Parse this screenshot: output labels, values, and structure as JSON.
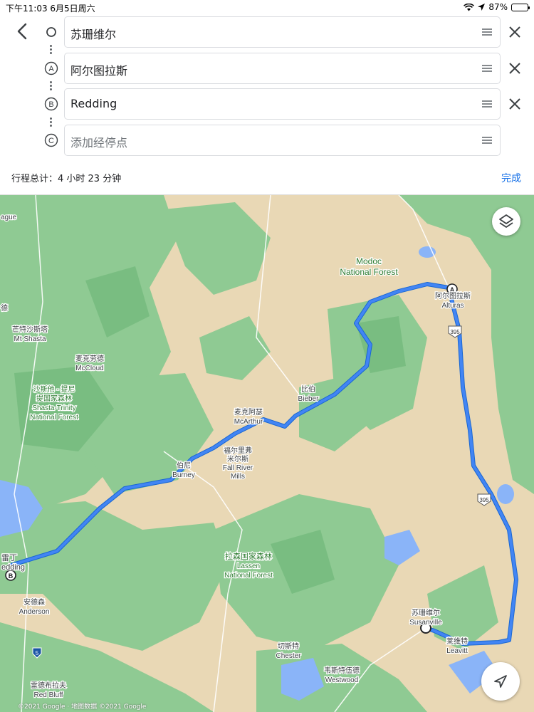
{
  "status_bar": {
    "time_date": "下午11:03   6月5日周六",
    "battery": "87%",
    "battery_level": 0.87
  },
  "route": {
    "stops": [
      {
        "marker": "",
        "value": "苏珊维尔"
      },
      {
        "marker": "A",
        "value": "阿尔图拉斯"
      },
      {
        "marker": "B",
        "value": "Redding"
      },
      {
        "marker": "C",
        "placeholder": "添加经停点"
      }
    ],
    "trip_total": "行程总计：4 小时 23 分钟",
    "done_label": "完成"
  },
  "map": {
    "colors": {
      "route": "#4285f4",
      "forest": "#8bc98b",
      "desert": "#e9d8b5",
      "water": "#8ab4f8"
    },
    "labels": {
      "modoc_cn": "Modoc",
      "modoc_en": "National Forest",
      "alturas_cn": "阿尔图拉斯",
      "alturas_en": "Alturas",
      "mtshasta_cn": "芒特沙斯塔",
      "mtshasta_en": "Mt Shasta",
      "mccloud_cn": "麦克劳德",
      "mccloud_en": "McCloud",
      "shasta_trinity_cn1": "沙斯他 - 提尼",
      "shasta_trinity_cn2": "提国家森林",
      "shasta_trinity_en1": "Shasta-Trinity",
      "shasta_trinity_en2": "National Forest",
      "bieber_cn": "比伯",
      "bieber_en": "Bieber",
      "mcarthur_cn": "麦克阿瑟",
      "mcarthur_en": "McArthur",
      "fallriver_cn1": "福尔里弗",
      "fallriver_cn2": "米尔斯",
      "fallriver_en1": "Fall River",
      "fallriver_en2": "Mills",
      "burney_cn": "伯尼",
      "burney_en": "Burney",
      "redding_cn": "雷丁",
      "redding_en": "edding",
      "lassen_cn": "拉森国家森林",
      "lassen_en1": "Lassen",
      "lassen_en2": "National Forest",
      "anderson_cn": "安德森",
      "anderson_en": "Anderson",
      "susanville_cn": "苏珊维尔",
      "susanville_en": "Susanville",
      "leavitt_cn": "莱维特",
      "leavitt_en": "Leavitt",
      "chester_cn": "切斯特",
      "chester_en": "Chester",
      "westwood_cn": "韦斯特伍德",
      "westwood_en": "Westwood",
      "redbluff_cn": "雷德布拉夫",
      "redbluff_en": "Red Bluff",
      "ague": "ague",
      "left_de": "德",
      "shield_395a": "395",
      "shield_395b": "395",
      "shield_5": "5",
      "marker_a": "A",
      "marker_b": "B"
    },
    "copyright": "©2021 Google · 地图数据 ©2021 Google"
  }
}
